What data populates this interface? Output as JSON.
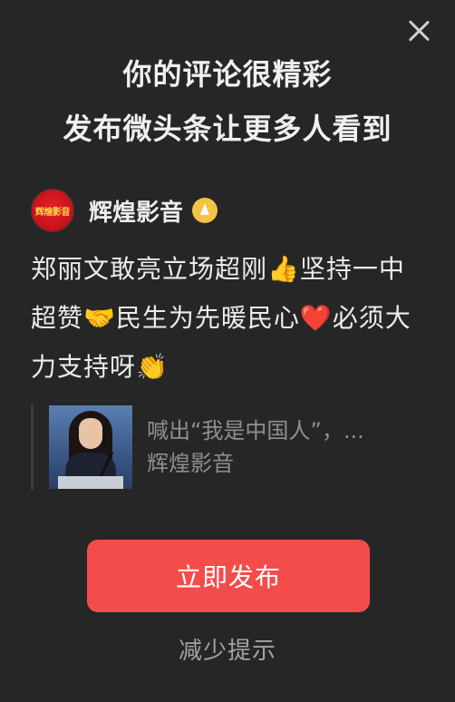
{
  "dialog": {
    "title_line1": "你的评论很精彩",
    "title_line2": "发布微头条让更多人看到",
    "close_icon": "close-icon"
  },
  "author": {
    "avatar_text": "辉煌影音",
    "name": "辉煌影音",
    "badge_icon": "verified-badge-icon",
    "badge_color": "#f5c344"
  },
  "comment": {
    "text": "郑丽文敢亮立场超刚👍坚持一中超赞🤝民生为先暖民心❤️必须大力支持呀👏"
  },
  "quoted_post": {
    "title": "喊出“我是中国人”，...",
    "source": "辉煌影音"
  },
  "actions": {
    "publish_label": "立即发布",
    "reduce_label": "减少提示",
    "publish_color": "#f44c4a"
  }
}
